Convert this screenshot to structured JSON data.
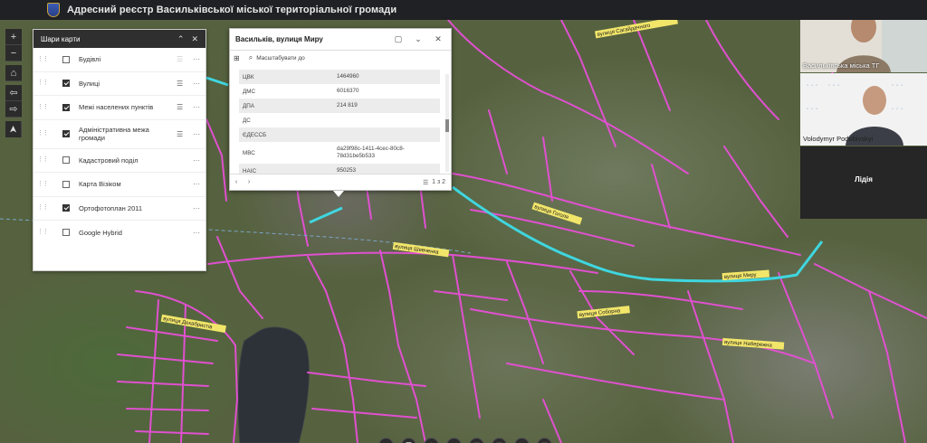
{
  "header": {
    "title": "Адресний реєстр Васильківської міської територіальної громади"
  },
  "map_tools": [
    {
      "icon": "zoom-in-icon",
      "glyph": "+"
    },
    {
      "icon": "zoom-out-icon",
      "glyph": "−"
    },
    {
      "icon": "home-icon",
      "glyph": "⌂"
    },
    {
      "icon": "back-icon",
      "glyph": "⇦"
    },
    {
      "icon": "forward-icon",
      "glyph": "⇨"
    },
    {
      "icon": "compass-icon",
      "glyph": "➤"
    }
  ],
  "layers_panel": {
    "title": "Шари карти",
    "items": [
      {
        "label": "Будівлі",
        "checked": false,
        "legend": false
      },
      {
        "label": "Вулиці",
        "checked": true,
        "legend": true
      },
      {
        "label": "Межі населених пунктів",
        "checked": true,
        "legend": true
      },
      {
        "label": "Адміністративна межа громади",
        "checked": true,
        "legend": true
      },
      {
        "label": "Кадастровий поділ",
        "checked": false,
        "legend": false
      },
      {
        "label": "Карта Візіком",
        "checked": false,
        "legend": false
      },
      {
        "label": "Ортофотоплан 2011",
        "checked": true,
        "legend": false
      },
      {
        "label": "Google Hybrid",
        "checked": false,
        "legend": false
      }
    ]
  },
  "popup": {
    "title": "Васильків, вулиця Миру",
    "zoom_label": "Масштабувати до",
    "rows": [
      {
        "key": "ЦВК",
        "value": "1464960"
      },
      {
        "key": "ДМС",
        "value": "6016370"
      },
      {
        "key": "ДПА",
        "value": "214 819"
      },
      {
        "key": "ДС",
        "value": ""
      },
      {
        "key": "ЄДЕССБ",
        "value": ""
      },
      {
        "key": "МВС",
        "value": "da29f98c-1411-4cec-80c8-78d31be5b533"
      },
      {
        "key": "НАІС",
        "value": "950253"
      }
    ],
    "counter": "1 з 2"
  },
  "street_labels": [
    "вулиця Сагайдачного",
    "вулиця Миру",
    "вулиця Гоголя",
    "вулиця Шевченка",
    "вулиця Декабристів",
    "вулиця Набережна",
    "вулиця Соборна"
  ],
  "bottom_tools": [
    "layers-icon",
    "list-icon",
    "chat-icon",
    "bookmark-icon",
    "print-icon",
    "filter-icon",
    "share-icon",
    "basemap-icon"
  ],
  "participants": [
    {
      "name": "Васильківська міська ТГ"
    },
    {
      "name": "Volodymyr Podobivskyi"
    },
    {
      "name": "Лідія"
    }
  ],
  "colors": {
    "street": "#e050d0",
    "selected_street": "#3fd6df",
    "header_bg": "#202124"
  }
}
